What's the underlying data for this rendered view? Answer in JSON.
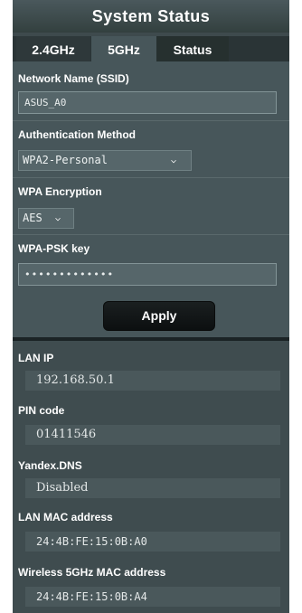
{
  "header": {
    "title": "System Status"
  },
  "tabs": [
    {
      "label": "2.4GHz"
    },
    {
      "label": "5GHz"
    },
    {
      "label": "Status"
    }
  ],
  "wifi_form": {
    "ssid_label": "Network Name (SSID)",
    "ssid_value": "ASUS_A0",
    "auth_label": "Authentication Method",
    "auth_value": "WPA2-Personal",
    "enc_label": "WPA Encryption",
    "enc_value": "AES",
    "psk_label": "WPA-PSK key",
    "psk_value": "•••••••••••••",
    "apply_label": "Apply"
  },
  "status": {
    "lan_ip_label": "LAN IP",
    "lan_ip_value": "192.168.50.1",
    "pin_label": "PIN code",
    "pin_value": "01411546",
    "dns_label": "Yandex.DNS",
    "dns_value": "Disabled",
    "lan_mac_label": "LAN MAC address",
    "lan_mac_value": "24:4B:FE:15:0B:A0",
    "wmac_label": "Wireless 5GHz MAC address",
    "wmac_value": "24:4B:FE:15:0B:A4"
  },
  "icons": {
    "dropdown": "chevron-down-icon"
  }
}
